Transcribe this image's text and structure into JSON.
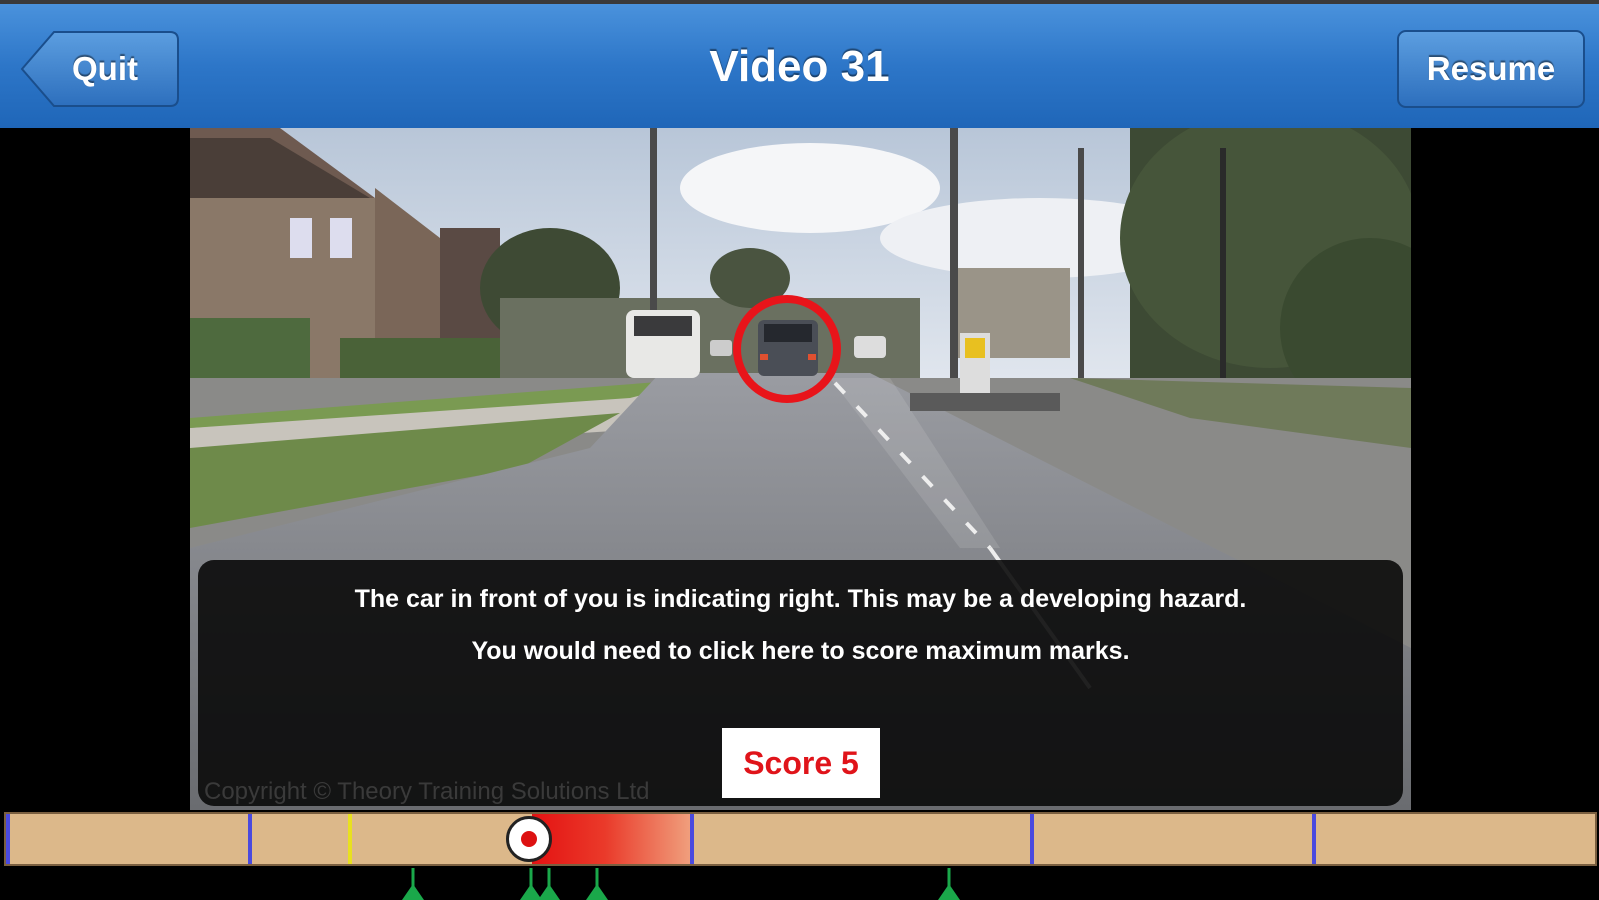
{
  "navbar": {
    "title": "Video 31",
    "quit_label": "Quit",
    "resume_label": "Resume"
  },
  "feedback": {
    "line1": "The car in front of you is indicating right. This may be a developing hazard.",
    "line2": "You would need to click here to score maximum marks.",
    "score_label": "Score 5"
  },
  "video": {
    "copyright": "Copyright © Theory Training Solutions Ltd"
  },
  "colors": {
    "nav_blue": "#2d76c8",
    "timeline": "#dcb88a",
    "score_red": "#e0141a",
    "hazard_circle": "#e8141a",
    "marker_green": "#1aa84a",
    "tick_blue": "#4a4adf",
    "tick_yellow": "#e8e020"
  }
}
